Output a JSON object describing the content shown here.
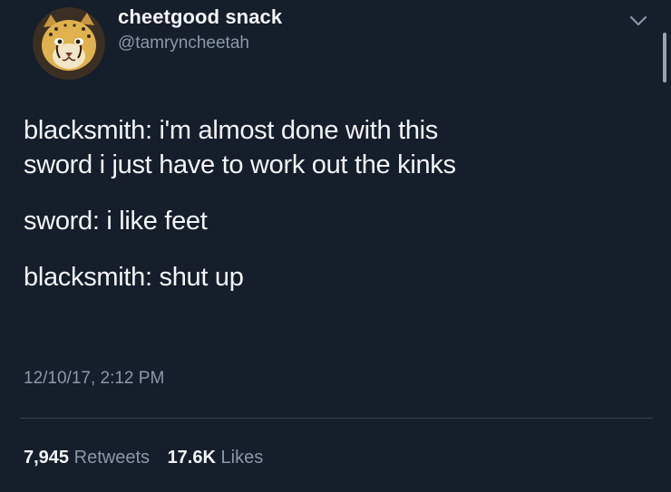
{
  "author": {
    "display_name": "cheetgood snack",
    "handle": "@tamryncheetah",
    "avatar_icon": "cheetah-avatar-icon"
  },
  "tweet": {
    "paragraphs": [
      {
        "lines": [
          "blacksmith: i'm almost done with this",
          "sword i just have to work out the kinks"
        ]
      },
      {
        "lines": [
          "sword: i like feet"
        ]
      },
      {
        "lines": [
          "blacksmith: shut up"
        ]
      }
    ],
    "timestamp": "12/10/17, 2:12 PM"
  },
  "stats": {
    "retweets_count": "7,945",
    "retweets_label": "Retweets",
    "likes_count": "17.6K",
    "likes_label": "Likes"
  },
  "colors": {
    "background": "#151e2b",
    "text_primary": "#f2f5f8",
    "text_secondary": "#8a98a8",
    "divider": "#38444f"
  }
}
